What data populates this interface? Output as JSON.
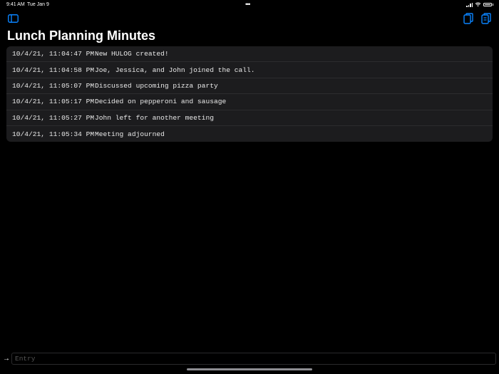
{
  "status_bar": {
    "time": "9:41 AM",
    "date": "Tue Jan 9",
    "dots": "•••"
  },
  "page": {
    "title": "Lunch Planning Minutes"
  },
  "log": {
    "entries": [
      {
        "time": "10/4/21, 11:04:47 PM",
        "text": "New HULOG created!"
      },
      {
        "time": "10/4/21, 11:04:58 PM",
        "text": "Joe, Jessica, and John joined the call."
      },
      {
        "time": "10/4/21, 11:05:07 PM",
        "text": "Discussed upcoming pizza party"
      },
      {
        "time": "10/4/21, 11:05:17 PM",
        "text": "Decided on pepperoni and sausage"
      },
      {
        "time": "10/4/21, 11:05:27 PM",
        "text": "John left for another meeting"
      },
      {
        "time": "10/4/21, 11:05:34 PM",
        "text": "Meeting adjourned"
      }
    ]
  },
  "entry": {
    "placeholder": "Entry",
    "value": "",
    "arrow": "→"
  },
  "colors": {
    "accent": "#0a84ff",
    "background": "#000000",
    "row_background": "#1c1c1e"
  },
  "icons": [
    "sidebar-toggle-icon",
    "copy-icon",
    "paste-icon",
    "wifi-icon",
    "battery-icon",
    "cellular-signal-icon"
  ]
}
